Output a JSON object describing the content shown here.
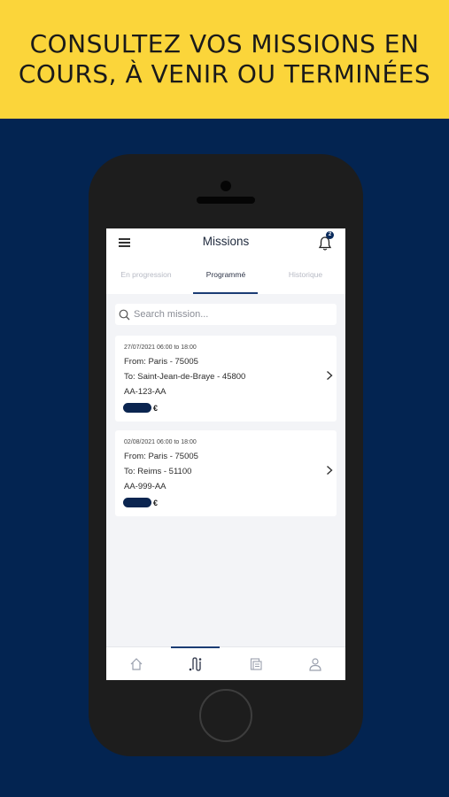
{
  "banner": {
    "line1": "CONSULTEZ VOS MISSIONS EN",
    "line2": "COURS, À VENIR OU TERMINÉES"
  },
  "app": {
    "title": "Missions",
    "menu_icon": "hamburger-menu-icon",
    "notification_icon": "bell-icon",
    "notification_count": "2"
  },
  "tabs": [
    {
      "label": "En progression",
      "active": false
    },
    {
      "label": "Programmé",
      "active": true
    },
    {
      "label": "Historique",
      "active": false
    }
  ],
  "search": {
    "placeholder": "Search mission...",
    "value": ""
  },
  "missions": [
    {
      "date": "27/07/2021 06:00 to 18:00",
      "from": "From: Paris - 75005",
      "to": "To: Saint-Jean-de-Braye - 45800",
      "plate": "AA-123-AA",
      "currency": "€"
    },
    {
      "date": "02/08/2021 06:00 to 18:00",
      "from": "From: Paris - 75005",
      "to": "To: Reims - 51100",
      "plate": "AA-999-AA",
      "currency": "€"
    }
  ],
  "bottom_nav": [
    {
      "icon": "home-icon",
      "active": false
    },
    {
      "icon": "route-icon",
      "active": true
    },
    {
      "icon": "documents-icon",
      "active": false
    },
    {
      "icon": "profile-icon",
      "active": false
    }
  ],
  "colors": {
    "banner": "#fbd53a",
    "background": "#032451",
    "accent": "#1b3c74"
  }
}
